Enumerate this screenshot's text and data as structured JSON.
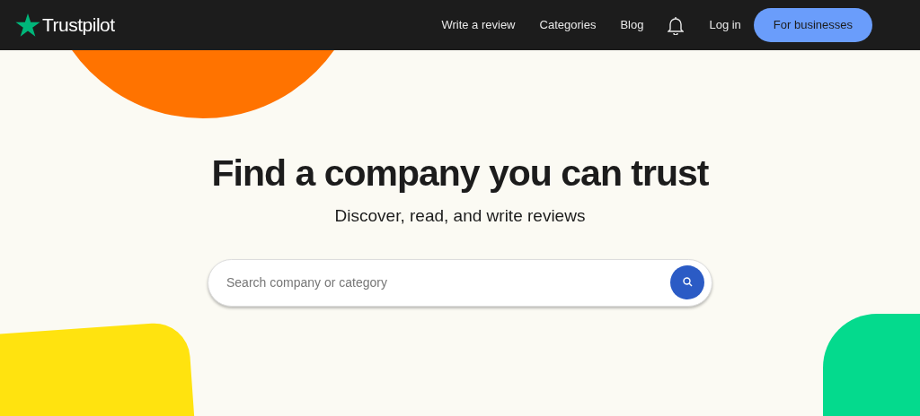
{
  "header": {
    "logo": "Trustpilot",
    "nav": [
      "Write a review",
      "Categories",
      "Blog"
    ],
    "login": "Log in",
    "cta": "For businesses"
  },
  "hero": {
    "title": "Find a company you can trust",
    "subtitle": "Discover, read, and write reviews",
    "search": {
      "placeholder": "Search company or category"
    }
  }
}
